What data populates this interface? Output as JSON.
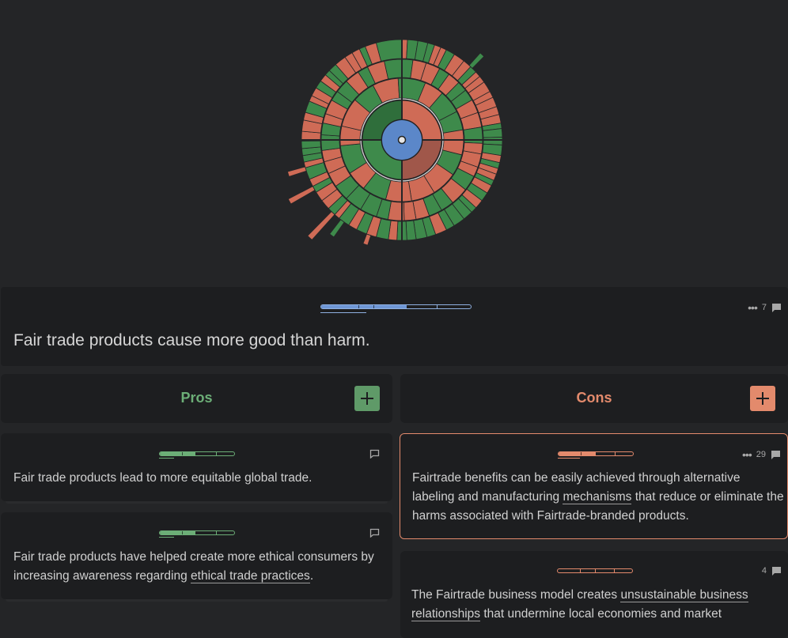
{
  "colors": {
    "background": "#242527",
    "card": "#1d1e20",
    "pro": "#6cae77",
    "con": "#e38a6c",
    "pro_segment": "#3e8a4b",
    "con_segment": "#cf6b56",
    "center": "#5b87c9"
  },
  "thesis": {
    "text": "Fair trade products cause more good than harm.",
    "comment_count": "7",
    "icons": [
      "more-icon",
      "comment-icon"
    ]
  },
  "pros": {
    "title": "Pros",
    "add_icon": "plus-icon",
    "items": [
      {
        "text": "Fair trade products lead to more equitable global trade.",
        "comment_count": ""
      },
      {
        "text_before": "Fair trade products have helped create more ethical consumers by increasing awareness regarding ",
        "link": "ethical trade practices",
        "text_after": ".",
        "comment_count": ""
      }
    ]
  },
  "cons": {
    "title": "Cons",
    "add_icon": "plus-icon",
    "items": [
      {
        "text_before": "Fairtrade benefits can be easily achieved through alternative labeling and manufacturing ",
        "link": "mechanisms",
        "text_after": " that reduce or eliminate the harms associated with Fairtrade-branded products.",
        "comment_count": "29"
      },
      {
        "text_before": "The Fairtrade business model creates ",
        "link": "unsustainable business relationships",
        "text_after": " that undermine local economies and market",
        "comment_count": "4"
      }
    ]
  }
}
